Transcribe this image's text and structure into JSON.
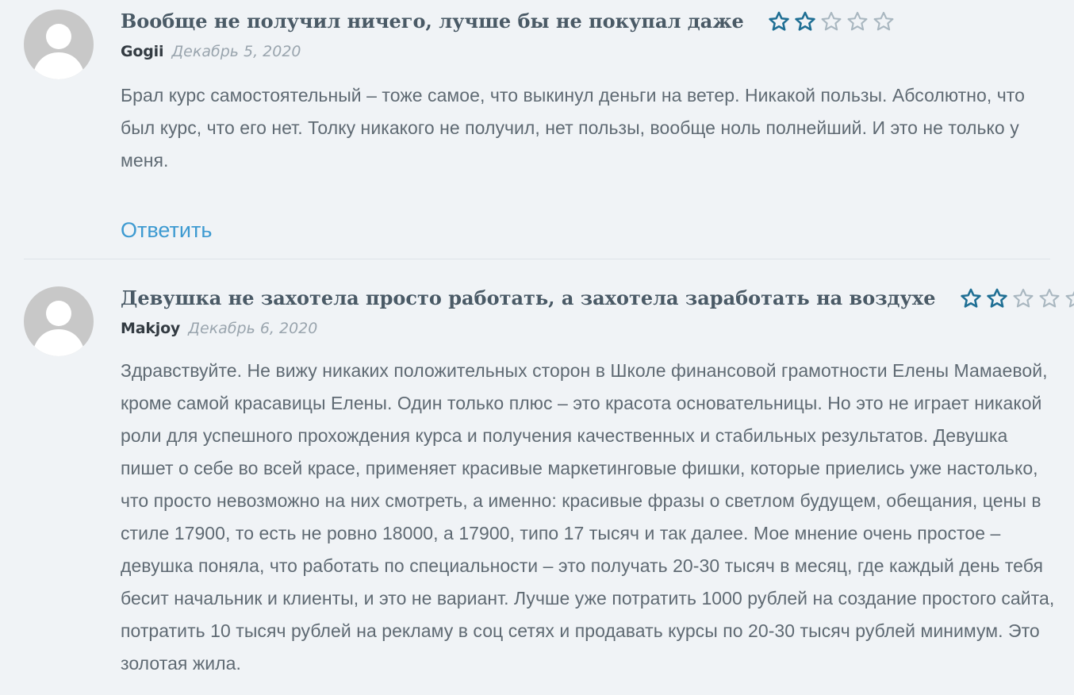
{
  "reviews": [
    {
      "title": "Вообще не получил ничего, лучше бы не покупал даже",
      "rating": 2,
      "max_rating": 5,
      "author": "Gogii",
      "date": "Декабрь 5, 2020",
      "text": "Брал курс самостоятельный – тоже самое, что выкинул деньги на ветер. Никакой пользы. Абсолютно, что был курс, что его нет. Толку никакого не получил, нет пользы, вообще ноль полнейший. И это не только у меня.",
      "reply_label": "Ответить"
    },
    {
      "title": "Девушка не захотела просто работать, а захотела заработать на воздухе",
      "rating": 2,
      "max_rating": 5,
      "author": "Makjoy",
      "date": "Декабрь 6, 2020",
      "text": "Здравствуйте. Не вижу никаких положительных сторон в Школе финансовой грамотности Елены Мамаевой, кроме самой красавицы Елены. Один только плюс – это красота основательницы. Но это не играет никакой роли для успешного прохождения курса и получения качественных и стабильных результатов. Девушка пишет о себе во всей красе, применяет красивые маркетинговые фишки, которые приелись уже настолько, что просто невозможно на них смотреть, а именно: красивые фразы о светлом будущем, обещания, цены в стиле 17900, то есть не ровно 18000, а 17900, типо 17 тысяч и так далее. Мое мнение очень простое – девушка поняла, что работать по специальности – это получать 20-30 тысяч в месяц, где каждый день тебя бесит начальник и клиенты, и это не вариант. Лучше уже потратить 1000 рублей на создание простого сайта, потратить 10 тысяч рублей на рекламу в соц сетях и продавать курсы по 20-30 тысяч рублей минимум. Это золотая жила."
    }
  ],
  "colors": {
    "background": "#f0f3f6",
    "star_filled": "#1f6f94",
    "star_empty": "#a9b7c0",
    "reply_link": "#3d9ad1",
    "avatar_bg": "#c8c8c8"
  },
  "icons": {
    "avatar": "user-avatar-icon",
    "star_filled": "star-filled-icon",
    "star_empty": "star-empty-icon"
  }
}
